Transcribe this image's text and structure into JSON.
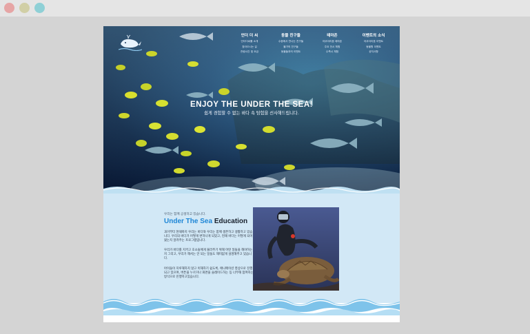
{
  "window": {
    "controls": [
      "close",
      "minimize",
      "maximize"
    ]
  },
  "header": {
    "logo_icon": "whale-icon",
    "nav": [
      {
        "label": "언더 더 씨",
        "items": [
          "언더더씨를 소개",
          "찾아오시는 길",
          "관람시간 및 요금"
        ]
      },
      {
        "label": "동물 친구들",
        "items": [
          "수중에서 만나는 친구들",
          "물가의 친구들",
          "동물들과의 이벤트"
        ]
      },
      {
        "label": "테마존",
        "items": [
          "아쿠아리움 테마존",
          "주요 전시 체험",
          "수족시 체험"
        ]
      },
      {
        "label": "이벤트의 소식",
        "items": [
          "아쿠아리움 이벤트",
          "동물원 이벤트",
          "공지사항"
        ]
      }
    ]
  },
  "hero": {
    "title": "ENJOY THE UNDER THE SEA!",
    "subtitle": "쉽게 경험할 수 없는 바다 속 탐험을 선사해드립니다."
  },
  "education": {
    "kicker": "우리는 함께 공생하고 있습니다.",
    "heading_accent": "Under The Sea",
    "heading_rest": "Education",
    "paragraphs": [
      "과거부터 현재까지 우리는 바다와 우리는 함께 생존하고 생활하고 있습니다. 우리의 바다가 어떻게 변하나게 되었고, 현재 바다는 어떻게 되어왔는지 알려주는 프로그램입니다.",
      "우리가 바다를 지키고 호소들에게 불러주기 위해 어떤 일들을 해야하는지 그리고, 우리가 해서는 안 되는 일들도 해미없게 설명해주고 있습니다.",
      "아이들이 지루해하지 않고 이해하기 쉽도록, 애니메이션 영상으로 진행되고 있으며, 버튼을 누르거나 화면을 슬레이드하는 등 너무해 참여하는 방식으로 진행하고있습니다."
    ],
    "photo_alt": "diver-with-sea-turtle"
  },
  "colors": {
    "accent": "#1e86d6",
    "section_bg": "#d2e8f6",
    "hero_dark": "#0b1f3d"
  }
}
